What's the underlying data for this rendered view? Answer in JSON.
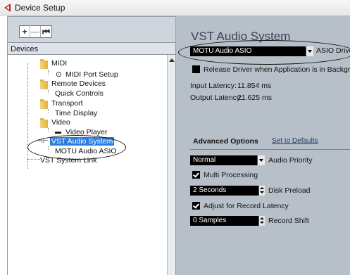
{
  "window": {
    "title": "Device Setup"
  },
  "toolbar": {
    "add": "+",
    "remove": "—",
    "reset": "⏮"
  },
  "devices": {
    "header": "Devices",
    "items": [
      {
        "label": "MIDI"
      },
      {
        "label": "MIDI Port Setup"
      },
      {
        "label": "Remote Devices"
      },
      {
        "label": "Quick Controls"
      },
      {
        "label": "Transport"
      },
      {
        "label": "Time Display"
      },
      {
        "label": "Video"
      },
      {
        "label": "Video Player"
      },
      {
        "label": "VST Audio System"
      },
      {
        "label": "MOTU Audio ASIO"
      },
      {
        "label": "VST System Link"
      }
    ]
  },
  "panel": {
    "title": "VST Audio System",
    "asio_driver_value": "MOTU Audio ASIO",
    "asio_driver_label": "ASIO Driver",
    "release_driver_label": "Release Driver when Application is in Background",
    "input_latency_label": "Input Latency:",
    "input_latency_value": "11.854 ms",
    "output_latency_label": "Output Latency:",
    "output_latency_value": "21.625 ms",
    "advanced_title": "Advanced Options",
    "set_defaults": "Set to Defaults",
    "audio_priority_value": "Normal",
    "audio_priority_label": "Audio Priority",
    "multi_processing_label": "Multi Processing",
    "disk_preload_value": "2 Seconds",
    "disk_preload_label": "Disk Preload",
    "adjust_latency_label": "Adjust for Record Latency",
    "record_shift_value": "0 Samples",
    "record_shift_label": "Record Shift"
  },
  "colors": {
    "selection": "#2c7de0",
    "frame": "#b7c0c9"
  }
}
